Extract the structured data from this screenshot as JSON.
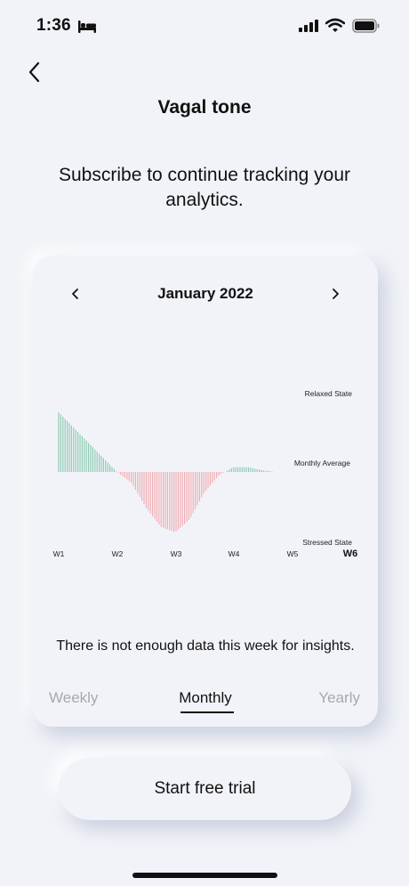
{
  "status_bar": {
    "time": "1:36",
    "icons": [
      "bed-icon",
      "cellular-signal-icon",
      "wifi-icon",
      "battery-icon"
    ]
  },
  "header": {
    "back_icon": "chevron-left-icon",
    "title": "Vagal tone"
  },
  "subtitle": "Subscribe to continue tracking your analytics.",
  "card": {
    "month": "January 2022",
    "prev_icon": "chevron-left-icon",
    "next_icon": "chevron-right-icon",
    "insight": "There is not enough data this week for insights.",
    "tabs": [
      {
        "label": "Weekly",
        "active": false
      },
      {
        "label": "Monthly",
        "active": true
      },
      {
        "label": "Yearly",
        "active": false
      }
    ]
  },
  "chart_data": {
    "type": "area",
    "title": "",
    "x_labels": [
      "W1",
      "W2",
      "W3",
      "W4",
      "W5",
      "W6"
    ],
    "highlighted_x": "W6",
    "y_labels": [
      "Relaxed State",
      "Monthly Average",
      "Stressed State"
    ],
    "ylim": [
      -1,
      1
    ],
    "baseline": 0,
    "series": [
      {
        "x": [
          1.0,
          1.25,
          1.5,
          1.75,
          2.0,
          2.25,
          2.5,
          2.75,
          3.0,
          3.25,
          3.5,
          3.75,
          4.0,
          4.25,
          4.5,
          4.75,
          5.0
        ],
        "values": [
          0.76,
          0.57,
          0.38,
          0.19,
          0.0,
          -0.14,
          -0.46,
          -0.7,
          -0.77,
          -0.6,
          -0.26,
          -0.04,
          0.06,
          0.06,
          0.02,
          0.0,
          0.0
        ]
      }
    ],
    "colors": {
      "above": "#8fcbb4",
      "below": "#efaeb4",
      "axis_text": "#222222"
    }
  },
  "cta": {
    "label": "Start free trial"
  }
}
